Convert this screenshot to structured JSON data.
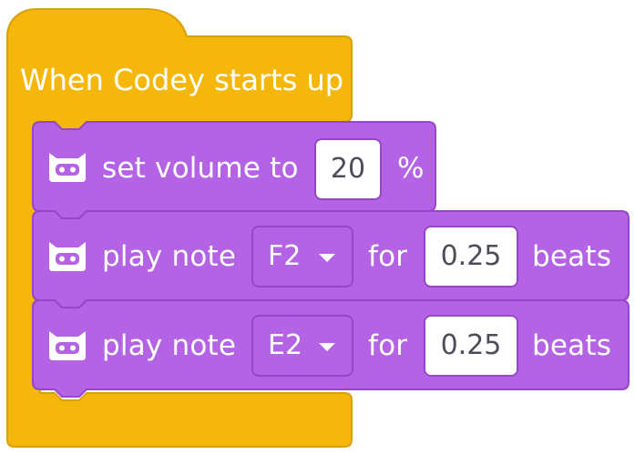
{
  "hat_block": {
    "label": "When Codey starts up",
    "color": "#f6b70d",
    "border_color": "#d9a00a"
  },
  "blocks": [
    {
      "id": "set-volume",
      "icon": "codey-robot-icon",
      "label": "set volume to",
      "value": "20",
      "suffix": "%"
    },
    {
      "id": "play-note-1",
      "icon": "codey-robot-icon",
      "label": "play note",
      "note": "F2",
      "for_label": "for",
      "duration": "0.25",
      "unit": "beats"
    },
    {
      "id": "play-note-2",
      "icon": "codey-robot-icon",
      "label": "play note",
      "note": "E2",
      "for_label": "for",
      "duration": "0.25",
      "unit": "beats"
    }
  ],
  "colors": {
    "block_purple": "#b363e4",
    "block_border": "#9646c9",
    "text": "#ffffff",
    "value_text": "#4c4c5a"
  }
}
